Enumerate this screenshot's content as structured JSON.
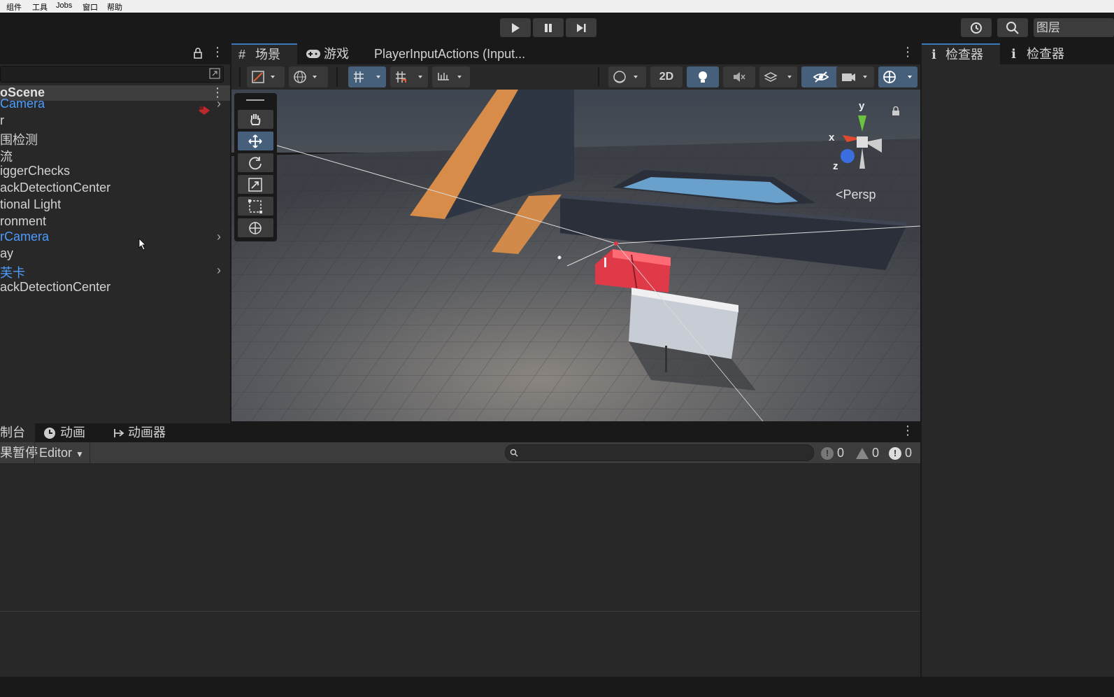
{
  "menubar": {
    "items": [
      "组件",
      "工具",
      "Jobs",
      "窗口",
      "帮助"
    ]
  },
  "toolbar": {
    "layers_label": "图层"
  },
  "hierarchy": {
    "scene_name": "oScene",
    "items": [
      {
        "label": "Camera",
        "color": "#4c9dff"
      },
      {
        "label": "r",
        "color": "#d2d2d2"
      },
      {
        "label": "围检测",
        "color": "#d2d2d2"
      },
      {
        "label": "流",
        "color": "#d2d2d2"
      },
      {
        "label": "iggerChecks",
        "color": "#d2d2d2"
      },
      {
        "label": "ackDetectionCenter",
        "color": "#d2d2d2"
      },
      {
        "label": "tional Light",
        "color": "#d2d2d2"
      },
      {
        "label": "ronment",
        "color": "#d2d2d2"
      },
      {
        "label": "rCamera",
        "color": "#4c9dff"
      },
      {
        "label": "ay",
        "color": "#d2d2d2"
      },
      {
        "label": "芙卡",
        "color": "#4c9dff"
      },
      {
        "label": "ackDetectionCenter",
        "color": "#d2d2d2"
      }
    ]
  },
  "scene": {
    "tabs": {
      "scene": "场景",
      "game": "游戏",
      "input": "PlayerInputActions (Input..."
    },
    "toolbar": {
      "mode_2d": "2D"
    },
    "persp_label": "Persp",
    "gizmo_axes": {
      "x": "x",
      "y": "y",
      "z": "z"
    }
  },
  "inspector": {
    "tab1": "检查器",
    "tab2": "检查器"
  },
  "console": {
    "tabs": {
      "console": "制台",
      "animation": "动画",
      "animator": "动画器"
    },
    "pause_label": "果暂停",
    "editor_dropdown": "Editor",
    "counts": {
      "log": "0",
      "warning": "0",
      "error": "0"
    }
  },
  "icons": [
    "play-icon",
    "pause-icon",
    "step-icon",
    "history-icon",
    "search-icon",
    "lock-icon",
    "kebab-icon"
  ]
}
